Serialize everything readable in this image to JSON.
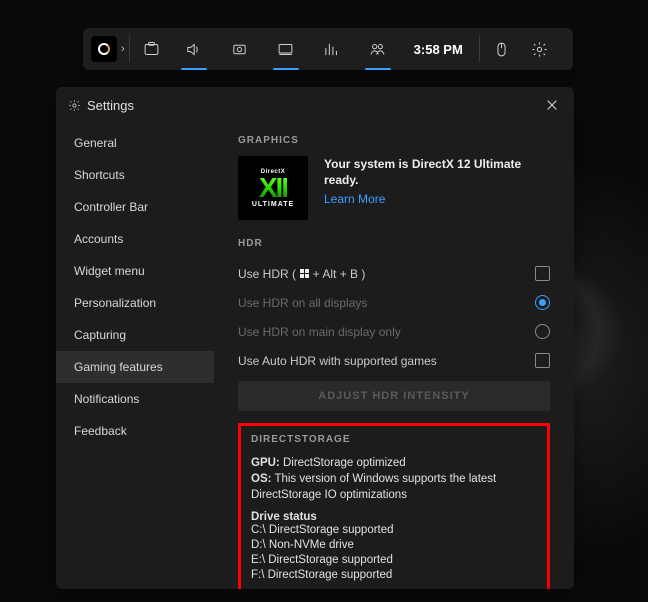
{
  "gamebar": {
    "time": "3:58 PM"
  },
  "settings": {
    "title": "Settings",
    "sidebar": [
      "General",
      "Shortcuts",
      "Controller Bar",
      "Accounts",
      "Widget menu",
      "Personalization",
      "Capturing",
      "Gaming features",
      "Notifications",
      "Feedback"
    ]
  },
  "graphics": {
    "heading": "GRAPHICS",
    "badge_top": "DirectX",
    "badge_mid": "XII",
    "badge_bot": "ULTIMATE",
    "ready_text": "Your system is DirectX 12 Ultimate ready.",
    "learn_more": "Learn More"
  },
  "hdr": {
    "heading": "HDR",
    "use_prefix": "Use HDR ( ",
    "use_suffix": " + Alt + B )",
    "all_displays": "Use HDR on all displays",
    "main_only": "Use HDR on main display only",
    "auto_hdr": "Use Auto HDR with supported games",
    "adjust_btn": "ADJUST HDR INTENSITY"
  },
  "directstorage": {
    "heading": "DIRECTSTORAGE",
    "gpu_label": "GPU:",
    "gpu_val": "DirectStorage optimized",
    "os_label": "OS:",
    "os_val": "This version of Windows supports the latest DirectStorage IO optimizations",
    "drive_status_h": "Drive status",
    "drives": [
      "C:\\ DirectStorage supported",
      "D:\\ Non-NVMe drive",
      "E:\\ DirectStorage supported",
      "F:\\ DirectStorage supported"
    ]
  }
}
